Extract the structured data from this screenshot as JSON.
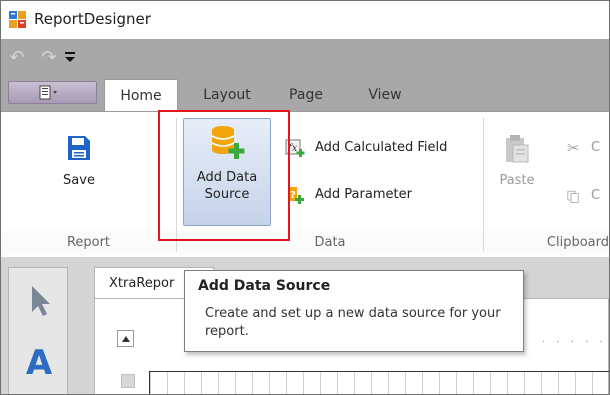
{
  "window": {
    "title": "ReportDesigner",
    "icon": "report-designer-app-icon"
  },
  "quick_access": {
    "undo_icon": "undo-icon",
    "redo_icon": "redo-icon",
    "customize_icon": "customize-dropdown-icon"
  },
  "tabs": [
    {
      "label": "Home",
      "active": true
    },
    {
      "label": "Layout",
      "active": false
    },
    {
      "label": "Page",
      "active": false
    },
    {
      "label": "View",
      "active": false
    }
  ],
  "ribbon": {
    "report_group": {
      "label": "Report",
      "save_label": "Save",
      "save_icon": "floppy-disk-icon"
    },
    "data_group": {
      "label": "Data",
      "add_data_source_line1": "Add Data",
      "add_data_source_line2": "Source",
      "add_data_source_icon": "database-add-icon",
      "add_calculated_field_label": "Add Calculated Field",
      "add_calculated_field_icon": "calculated-field-icon",
      "add_parameter_label": "Add Parameter",
      "add_parameter_icon": "parameter-icon"
    },
    "clipboard_group": {
      "label": "Clipboard",
      "paste_label": "Paste",
      "cut_label": "C",
      "copy_label": "C"
    }
  },
  "designer": {
    "doc_tab_label": "XtraRepor",
    "toolbox_text_tool": "A",
    "ruler_text": "· · · · ·"
  },
  "tooltip": {
    "title": "Add Data Source",
    "body": "Create and set up a new data source for your report."
  },
  "colors": {
    "highlight": "#e0171e",
    "qat_background": "#a8a8a8",
    "accent_blue": "#1f64c8",
    "db_orange": "#f2a60c",
    "add_green": "#3aa93a"
  }
}
